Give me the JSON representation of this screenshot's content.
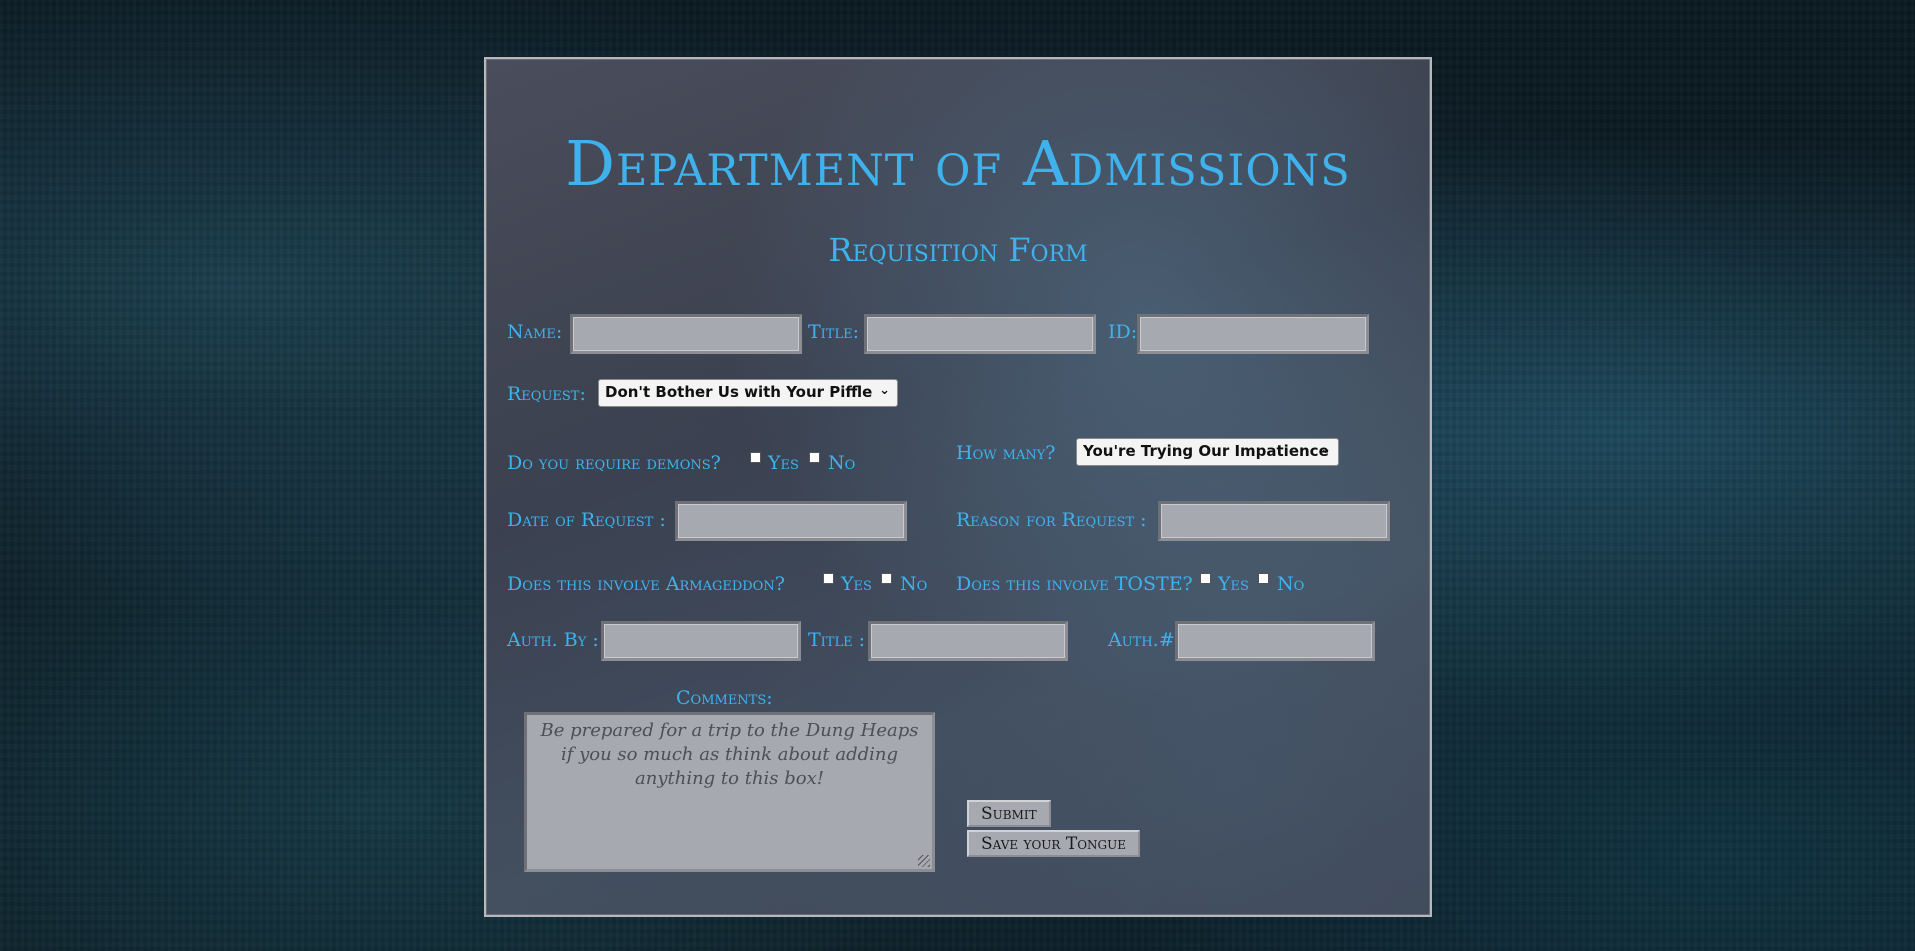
{
  "header": {
    "title": "Department of Admissions",
    "subtitle": "Requisition Form"
  },
  "form": {
    "name_label": "Name:",
    "title_label": "Title:",
    "id_label": "ID:",
    "request_label": "Request:",
    "request_value": "Don't Bother Us with Your Piffle",
    "demons_label": "Do you require demons?",
    "yes_label": "Yes",
    "no_label": "No",
    "how_many_label": "How many?",
    "how_many_value": "You're Trying Our Impatience",
    "date_label": "Date of Request :",
    "reason_label": "Reason for Request :",
    "armageddon_label": "Does this involve Armageddon?",
    "toste_label": "Does this involve TOSTE?",
    "auth_by_label": "Auth. By :",
    "auth_title_label": "Title :",
    "auth_num_label": "Auth.#",
    "comments_label": "Comments:",
    "comments_placeholder": "Be prepared for a trip to the Dung Heaps if you so much as think about adding anything to this box!",
    "submit_label": "Submit",
    "cancel_label": "Save your Tongue"
  },
  "icons": {
    "dropdown": "chevron-down-icon"
  },
  "colors": {
    "accent": "#3fb2ee",
    "field": "#a7a9b0"
  }
}
